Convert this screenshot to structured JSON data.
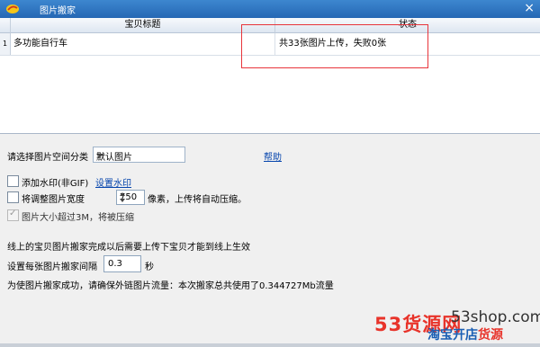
{
  "window": {
    "title": "图片搬家",
    "close": "×"
  },
  "grid": {
    "columns": [
      "宝贝标题",
      "状态"
    ],
    "rows": [
      {
        "num": "1",
        "title": "多功能自行车",
        "status": "共33张图片上传，失败0张"
      }
    ]
  },
  "options": {
    "category_label": "请选择图片空间分类",
    "category_value": "默认图片",
    "help_link": "帮助",
    "watermark_label": "添加水印(非GIF)",
    "watermark_link": "设置水印",
    "resize_label": "将调整图片宽度",
    "resize_value": "750",
    "resize_suffix": "像素，上传将自动压缩。",
    "compress_label": "图片大小超过3M，将被压缩",
    "note": "线上的宝贝图片搬家完成以后需要上传下宝贝才能到线上生效",
    "interval_label": "设置每张图片搬家间隔",
    "interval_value": "0.3",
    "interval_unit": "秒",
    "traffic_text": "为使图片搬家成功，请确保外链图片流量：本次搬家总共使用了0.344727Mb流量"
  },
  "watermark": {
    "brand_red": "53货源网",
    "domain": "53shop.com",
    "slogan_blue": "淘宝开店",
    "slogan_red": "货源"
  }
}
